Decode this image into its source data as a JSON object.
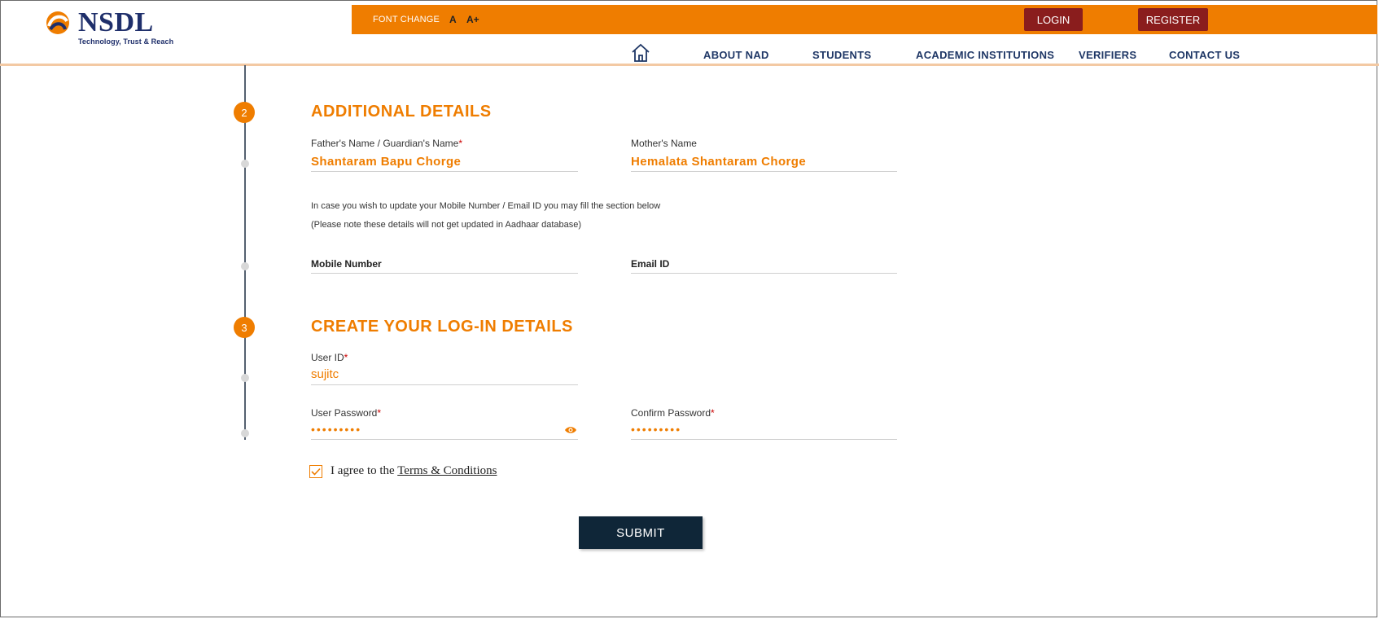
{
  "brand": {
    "name": "NSDL",
    "tagline": "Technology, Trust & Reach",
    "accent": "#ef7d00",
    "navy": "#1f3766",
    "dark_red": "#8a1d1d"
  },
  "topbar": {
    "font_change": "FONT CHANGE",
    "font_small": "A",
    "font_large": "A+",
    "login": "LOGIN",
    "register": "REGISTER"
  },
  "nav": {
    "home_icon": "home-icon",
    "items": [
      "ABOUT NAD",
      "STUDENTS",
      "ACADEMIC INSTITUTIONS",
      "VERIFIERS",
      "CONTACT US"
    ]
  },
  "additional": {
    "step": "2",
    "title": "ADDITIONAL DETAILS",
    "father_label": "Father's Name / Guardian's Name",
    "father_value": "Shantaram Bapu Chorge",
    "mother_label": "Mother's Name",
    "mother_value": "Hemalata Shantaram Chorge",
    "note1": "In case you wish to update your Mobile Number / Email ID you may fill the section below",
    "note2": "(Please note these details will not get updated in Aadhaar database)",
    "mobile_label": "Mobile Number",
    "email_label": "Email ID"
  },
  "login_details": {
    "step": "3",
    "title": "CREATE YOUR LOG-IN DETAILS",
    "userid_label": "User ID",
    "userid_value": "sujitc",
    "password_label": "User Password",
    "password_value": "•••••••••",
    "confirm_label": "Confirm Password",
    "confirm_value": "•••••••••"
  },
  "agree": {
    "prefix": "I agree to the ",
    "link": "Terms & Conditions",
    "checked": true
  },
  "submit_label": "SUBMIT",
  "required_mark": "*"
}
